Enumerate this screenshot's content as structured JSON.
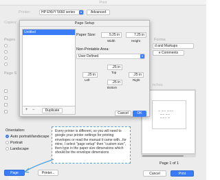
{
  "print_dialog": {
    "title": "Print",
    "printer_label": "Printer:",
    "printer_value": "HP ENVY 5660 series",
    "advanced_label": "Advanced",
    "copies_label": "Copies:",
    "pages_label": "Pages",
    "page_sizing_label": "Page S",
    "forms_label": "Forms",
    "forms_option": "d and Markups",
    "comments_button": "e Comments",
    "size_value": "nches",
    "orientation_label": "Orientation:",
    "orientation_options": [
      "Auto portrait/landscape",
      "Portrait",
      "Landscape"
    ],
    "page_indicator": "Page 1 of 1",
    "page_setup_button": "Page Setup...",
    "printer_button": "Printer...",
    "cancel_button": "Cancel",
    "print_button": "Print"
  },
  "page_setup": {
    "title": "Page Setup",
    "list_items": [
      "Untitled"
    ],
    "add_icon": "+",
    "remove_icon": "−",
    "duplicate_label": "Duplicate",
    "paper_size_label": "Paper Size:",
    "width_value": "5.25 in",
    "height_value": "7.25 in",
    "width_label": "Width",
    "height_label": "Height",
    "non_printable_label": "Non-Printable Area:",
    "non_printable_value": "User Defined",
    "top_value": ".25 in",
    "left_value": ".25 in",
    "right_value": ".25 in",
    "bottom_value": ".25 in",
    "top_label": "Top",
    "left_label": "Left",
    "right_label": "Right",
    "bottom_label": "Bottom",
    "cancel_button": "Cancel",
    "ok_button": "OK"
  },
  "annotation": {
    "text": "Every printer is different, so you will need to google your printer settings for printing envelopes or read the manual it came with...for mine, I select \"page setup\" then \"custom size\", then type in the paper size dimensions which should be the envelope dimensions"
  },
  "colors": {
    "accent": "#3a7df6",
    "callout": "#4aa3e0"
  }
}
